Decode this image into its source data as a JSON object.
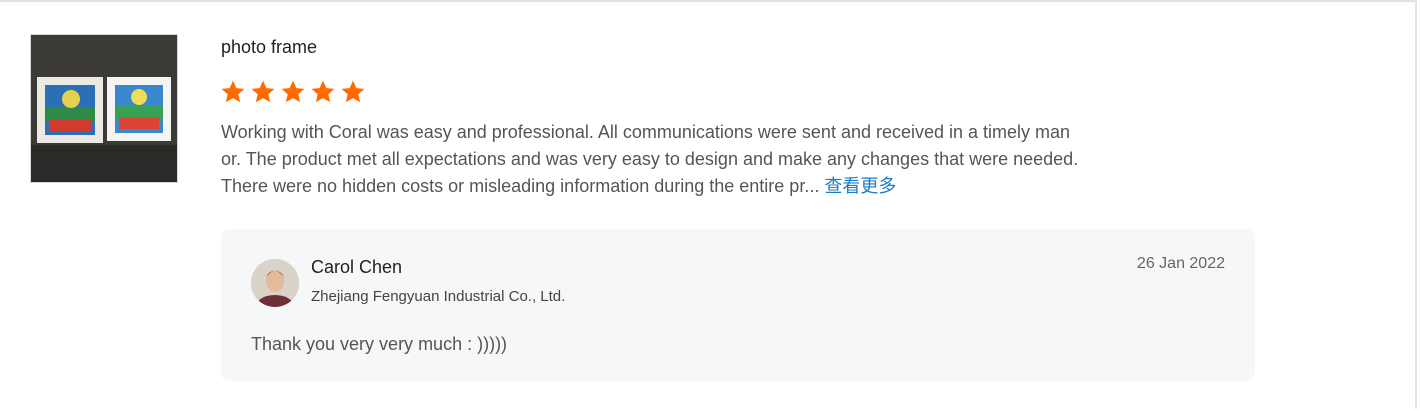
{
  "review": {
    "product_name": "photo frame",
    "rating": 5,
    "rating_max": 5,
    "star_color": "#ff6a00",
    "text": "Working with Coral was easy and professional. All communications were sent and received in a timely man\nor. The product met all expectations and was very easy to design and make any changes that were needed.\nThere were no hidden costs or misleading information during the entire pr... ",
    "see_more_label": "查看更多",
    "thumbnail_icon": "photo-frame-thumbnail"
  },
  "reply": {
    "name": "Carol Chen",
    "company": "Zhejiang Fengyuan Industrial Co., Ltd.",
    "date": "26 Jan 2022",
    "text": "Thank you very very much : )))))",
    "avatar_icon": "avatar"
  }
}
